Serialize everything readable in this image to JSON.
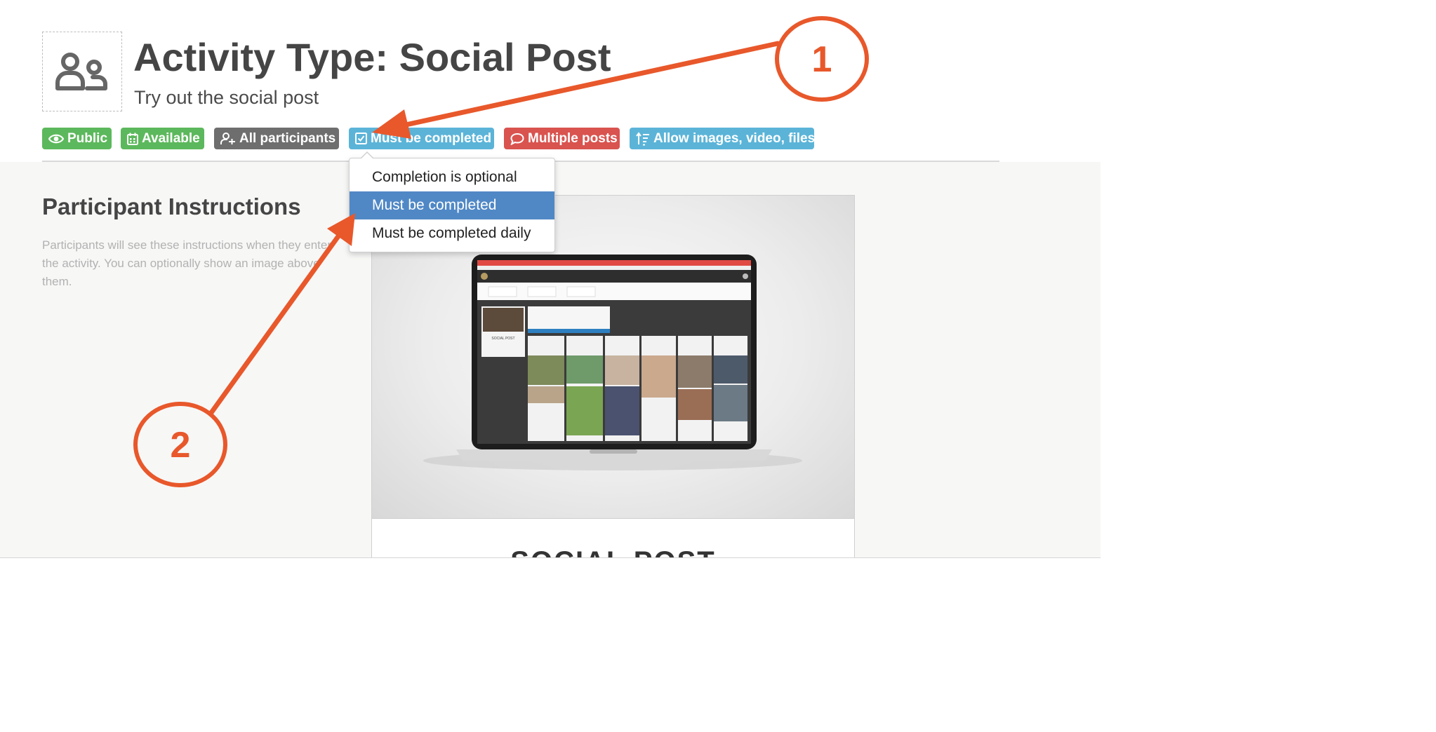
{
  "header": {
    "title": "Activity Type: Social Post",
    "subtitle": "Try out the social post",
    "icon": "users-icon"
  },
  "badges": [
    {
      "label": "Public",
      "icon": "eye-icon",
      "color": "#5cb85c"
    },
    {
      "label": "Available",
      "icon": "calendar-icon",
      "color": "#5cb85c"
    },
    {
      "label": "All participants",
      "icon": "user-group-icon",
      "color": "#6e6e6e"
    },
    {
      "label": "Must be completed",
      "icon": "checkbox-icon",
      "color": "#5bb4d8"
    },
    {
      "label": "Multiple posts",
      "icon": "speech-bubble-icon",
      "color": "#d9534f"
    },
    {
      "label": "Allow images, video, files",
      "icon": "sort-list-icon",
      "color": "#5bb4d8"
    }
  ],
  "dropdown": {
    "options": [
      "Completion is optional",
      "Must be completed",
      "Must be completed daily"
    ],
    "selected": "Must be completed",
    "highlight_color": "#5088c6"
  },
  "instructions": {
    "title": "Participant Instructions",
    "text": "Participants will see these instructions when they enter the activity. You can optionally show an image above them."
  },
  "preview": {
    "caption": "SOCIAL POST",
    "image": "laptop-screenshot",
    "laptop_screen_text": "SOCIAL POST"
  },
  "annotations": {
    "callouts": [
      "1",
      "2"
    ],
    "color": "#e8582b"
  }
}
